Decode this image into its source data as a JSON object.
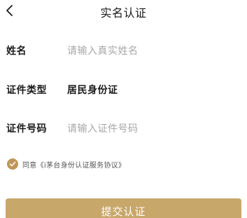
{
  "nav": {
    "title": "实名认证",
    "back_icon": "chevron-left-icon"
  },
  "form": {
    "name": {
      "label": "姓名",
      "placeholder": "请输入真实姓名",
      "value": ""
    },
    "id_type": {
      "label": "证件类型",
      "value": "居民身份证"
    },
    "id_number": {
      "label": "证件号码",
      "placeholder": "请输入证件号码",
      "value": ""
    }
  },
  "agreement": {
    "checked": true,
    "check_icon": "checkmark-icon",
    "prefix": "同意",
    "link_text": "《i茅台身份认证服务协议》"
  },
  "submit": {
    "label": "提交认证"
  },
  "colors": {
    "accent": "#c09658",
    "button": "#c8a76b",
    "placeholder": "#a7a7a7",
    "text": "#1a1a1a"
  }
}
